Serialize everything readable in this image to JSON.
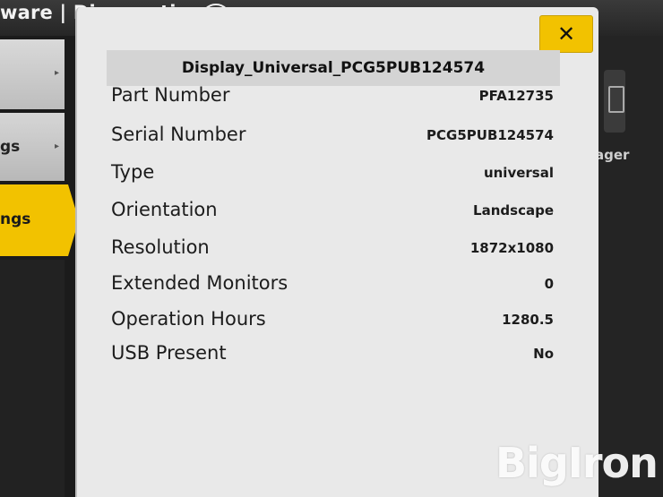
{
  "header": {
    "title": "ware | Diagnostics",
    "help_icon": "help-circle-icon"
  },
  "nav": [
    {
      "label": "",
      "arrow": "▸"
    },
    {
      "label": "gs",
      "arrow": "▸"
    },
    {
      "label": "ngs",
      "selected": true
    }
  ],
  "right_panel": {
    "manager_label": "ager"
  },
  "modal": {
    "close_label": "✕",
    "title": "Display_Universal_PCG5PUB124574",
    "rows": [
      {
        "label": "Part Number",
        "value": "PFA12735"
      },
      {
        "label": "Serial Number",
        "value": "PCG5PUB124574"
      },
      {
        "label": "Type",
        "value": "universal"
      },
      {
        "label": "Orientation",
        "value": "Landscape"
      },
      {
        "label": "Resolution",
        "value": "1872x1080"
      },
      {
        "label": "Extended Monitors",
        "value": "0"
      },
      {
        "label": "Operation Hours",
        "value": "1280.5"
      },
      {
        "label": "USB Present",
        "value": "No"
      }
    ]
  },
  "watermark": "BigIron",
  "colors": {
    "accent": "#f2c200",
    "modal_bg": "#e9e9e9",
    "header_bg": "#2e2e2e"
  }
}
